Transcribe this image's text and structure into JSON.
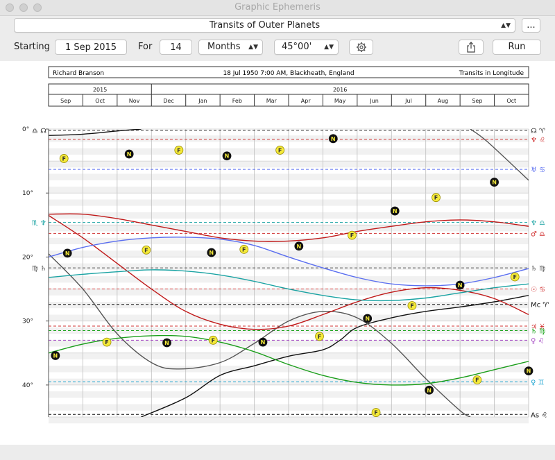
{
  "window": {
    "title": "Graphic Ephemeris"
  },
  "toolbar": {
    "chart_type": "Transits of Outer Planets",
    "more_label": "...",
    "starting_label": "Starting",
    "start_date": "1 Sep 2015",
    "for_label": "For",
    "duration": "14",
    "unit": "Months",
    "range": "45°00'",
    "run_label": "Run"
  },
  "chart_data": {
    "type": "line",
    "header": {
      "name": "Richard Branson",
      "birth": "18 Jul 1950 7:00 AM, Blackheath, England",
      "mode": "Transits in Longitude"
    },
    "years": [
      {
        "label": "2015",
        "from": 0,
        "to": 3
      },
      {
        "label": "2016",
        "from": 3,
        "to": 14
      }
    ],
    "months": [
      "Sep",
      "Oct",
      "Nov",
      "Dec",
      "Jan",
      "Feb",
      "Mar",
      "Apr",
      "May",
      "Jun",
      "Jul",
      "Aug",
      "Sep",
      "Oct"
    ],
    "ylim": [
      0,
      45
    ],
    "yticks": [
      {
        "v": 0,
        "label": "0°"
      },
      {
        "v": 10,
        "label": "10°"
      },
      {
        "v": 20,
        "label": "20°"
      },
      {
        "v": 30,
        "label": "30°"
      },
      {
        "v": 40,
        "label": "40°"
      }
    ],
    "natal_lines": [
      {
        "v": 0.2,
        "color": "#333333",
        "left": "♎ ☊",
        "right": "☊ ♈"
      },
      {
        "v": 1.6,
        "color": "#d03030",
        "left": "",
        "right": "♆ ♌"
      },
      {
        "v": 6.3,
        "color": "#5a6ef0",
        "left": "",
        "right": "♅ ♋"
      },
      {
        "v": 14.6,
        "color": "#1aa3a3",
        "left": "♏ ♆",
        "right": "♆ ♎"
      },
      {
        "v": 16.3,
        "color": "#d03030",
        "left": "",
        "right": "♂ ♎"
      },
      {
        "v": 21.7,
        "color": "#555555",
        "left": "♍ ♄",
        "right": "♄ ♍"
      },
      {
        "v": 25.0,
        "color": "#d03030",
        "left": "",
        "right": "☉ ♋"
      },
      {
        "v": 27.4,
        "color": "#111111",
        "left": "",
        "right": "Mc ♈"
      },
      {
        "v": 30.8,
        "color": "#d03030",
        "left": "",
        "right": "♃ ♓"
      },
      {
        "v": 31.5,
        "color": "#1aa31a",
        "left": "",
        "right": "♄ ♍"
      },
      {
        "v": 33.0,
        "color": "#a040c0",
        "left": "",
        "right": "♀ ♌"
      },
      {
        "v": 39.5,
        "color": "#1aa3d0",
        "left": "",
        "right": "♀ ♊"
      },
      {
        "v": 44.6,
        "color": "#111111",
        "left": "",
        "right": "As ♌"
      }
    ],
    "series": [
      {
        "name": "☊",
        "color": "#111111",
        "points": [
          [
            0,
            1
          ],
          [
            1,
            0.8
          ],
          [
            2,
            0.3
          ],
          [
            2.7,
            0
          ]
        ]
      },
      {
        "name": "☊",
        "color": "#111111",
        "points": [
          [
            2.7,
            45
          ],
          [
            4,
            42
          ],
          [
            5,
            38.5
          ],
          [
            6,
            37
          ],
          [
            7,
            35.5
          ],
          [
            8,
            34.5
          ],
          [
            8.5,
            33
          ],
          [
            9,
            31
          ],
          [
            10,
            29.5
          ],
          [
            11,
            28.5
          ],
          [
            12,
            27.8
          ],
          [
            13,
            27
          ],
          [
            14,
            26
          ]
        ]
      },
      {
        "name": "♄",
        "color": "#555555",
        "points": [
          [
            0,
            19.5
          ],
          [
            1,
            25
          ],
          [
            2,
            32
          ],
          [
            3,
            36.5
          ],
          [
            3.8,
            37.5
          ],
          [
            5,
            36.5
          ],
          [
            6,
            33.5
          ],
          [
            7,
            30
          ],
          [
            8,
            28.5
          ],
          [
            9,
            29.5
          ],
          [
            10,
            33.5
          ],
          [
            11,
            39
          ],
          [
            12,
            44
          ],
          [
            12.3,
            45
          ]
        ]
      },
      {
        "name": "♄",
        "color": "#555555",
        "points": [
          [
            12.3,
            0
          ],
          [
            12.8,
            2
          ],
          [
            14,
            8
          ]
        ]
      },
      {
        "name": "♃",
        "color": "#c01a1a",
        "points": [
          [
            0,
            13.3
          ],
          [
            1,
            13.3
          ],
          [
            2,
            14
          ],
          [
            3,
            15
          ],
          [
            4,
            16
          ],
          [
            5,
            17
          ],
          [
            6,
            17.5
          ],
          [
            7,
            17.5
          ],
          [
            8,
            17
          ],
          [
            9,
            16
          ],
          [
            10,
            15.2
          ],
          [
            11,
            14.5
          ],
          [
            12,
            14.2
          ],
          [
            13,
            14.5
          ],
          [
            14,
            15.2
          ]
        ]
      },
      {
        "name": "♂",
        "color": "#c01a1a",
        "points": [
          [
            0,
            13.5
          ],
          [
            1,
            17
          ],
          [
            2,
            21
          ],
          [
            3,
            25
          ],
          [
            4,
            28.5
          ],
          [
            5,
            30.5
          ],
          [
            6,
            31.3
          ],
          [
            7,
            30.8
          ],
          [
            8,
            29
          ],
          [
            9,
            27
          ],
          [
            10,
            25.5
          ],
          [
            11,
            24.8
          ],
          [
            12,
            25.2
          ],
          [
            13,
            26.5
          ],
          [
            14,
            29
          ]
        ]
      },
      {
        "name": "♅",
        "color": "#5a6ef0",
        "points": [
          [
            0,
            20
          ],
          [
            1,
            18.5
          ],
          [
            2,
            17.5
          ],
          [
            3,
            17
          ],
          [
            4,
            16.9
          ],
          [
            5,
            17.2
          ],
          [
            6,
            18.2
          ],
          [
            7,
            20
          ],
          [
            8,
            21.7
          ],
          [
            9,
            23.2
          ],
          [
            10,
            24.2
          ],
          [
            11,
            24.5
          ],
          [
            12,
            24.2
          ],
          [
            13,
            23.2
          ],
          [
            14,
            21.8
          ]
        ]
      },
      {
        "name": "♆",
        "color": "#1aa3a3",
        "points": [
          [
            0,
            23.2
          ],
          [
            1,
            22.7
          ],
          [
            2,
            22.3
          ],
          [
            3,
            22
          ],
          [
            4,
            22.2
          ],
          [
            5,
            22.8
          ],
          [
            6,
            23.8
          ],
          [
            7,
            25
          ],
          [
            8,
            26
          ],
          [
            9,
            26.7
          ],
          [
            10,
            26.8
          ],
          [
            11,
            26.4
          ],
          [
            12,
            25.6
          ],
          [
            13,
            24.8
          ],
          [
            14,
            24.2
          ]
        ]
      },
      {
        "name": "♇",
        "color": "#1a9e1a",
        "points": [
          [
            0,
            35
          ],
          [
            1,
            33.6
          ],
          [
            2,
            32.7
          ],
          [
            3,
            32.3
          ],
          [
            4,
            32.4
          ],
          [
            5,
            33.3
          ],
          [
            6,
            34.8
          ],
          [
            7,
            36.8
          ],
          [
            8,
            38.5
          ],
          [
            9,
            39.6
          ],
          [
            10,
            40
          ],
          [
            11,
            39.8
          ],
          [
            12,
            38.9
          ],
          [
            13,
            37.6
          ],
          [
            14,
            36.3
          ]
        ]
      }
    ],
    "markers": [
      {
        "sym": "F",
        "t": 0.45,
        "v": 4.6
      },
      {
        "sym": "N",
        "t": 2.35,
        "v": 3.9
      },
      {
        "sym": "F",
        "t": 3.8,
        "v": 3.3
      },
      {
        "sym": "N",
        "t": 5.2,
        "v": 4.2
      },
      {
        "sym": "F",
        "t": 6.75,
        "v": 3.3
      },
      {
        "sym": "N",
        "t": 8.3,
        "v": 1.5
      },
      {
        "sym": "N",
        "t": 10.1,
        "v": 12.8
      },
      {
        "sym": "F",
        "t": 11.3,
        "v": 10.7
      },
      {
        "sym": "N",
        "t": 13.0,
        "v": 8.3
      },
      {
        "sym": "N",
        "t": 0.55,
        "v": 19.4
      },
      {
        "sym": "F",
        "t": 2.85,
        "v": 18.9
      },
      {
        "sym": "N",
        "t": 4.75,
        "v": 19.3
      },
      {
        "sym": "F",
        "t": 5.7,
        "v": 18.8
      },
      {
        "sym": "N",
        "t": 7.3,
        "v": 18.3
      },
      {
        "sym": "F",
        "t": 8.85,
        "v": 16.6
      },
      {
        "sym": "F",
        "t": 13.6,
        "v": 23.1
      },
      {
        "sym": "N",
        "t": 12.0,
        "v": 24.4
      },
      {
        "sym": "F",
        "t": 10.6,
        "v": 27.6
      },
      {
        "sym": "N",
        "t": 9.3,
        "v": 29.6
      },
      {
        "sym": "F",
        "t": 7.9,
        "v": 32.4
      },
      {
        "sym": "F",
        "t": 1.7,
        "v": 33.3
      },
      {
        "sym": "N",
        "t": 3.45,
        "v": 33.4
      },
      {
        "sym": "F",
        "t": 4.8,
        "v": 33.0
      },
      {
        "sym": "N",
        "t": 6.25,
        "v": 33.3
      },
      {
        "sym": "N",
        "t": 0.2,
        "v": 35.4
      },
      {
        "sym": "N",
        "t": 11.1,
        "v": 40.8
      },
      {
        "sym": "F",
        "t": 12.5,
        "v": 39.2
      },
      {
        "sym": "N",
        "t": 14.0,
        "v": 37.8
      },
      {
        "sym": "F",
        "t": 9.55,
        "v": 44.3
      }
    ]
  }
}
